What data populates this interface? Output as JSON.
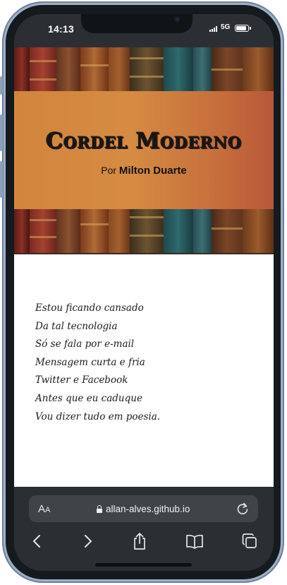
{
  "status_bar": {
    "time": "14:13",
    "network": "5G"
  },
  "header": {
    "site_title": "Cordel Moderno",
    "byline_prefix": "Por",
    "author": "Milton Duarte",
    "banner_gradient_colors": [
      "#d2863d",
      "#c56d3b",
      "#b8573a"
    ]
  },
  "poem": {
    "lines": [
      "Estou ficando cansado",
      "Da tal tecnologia",
      "Só se fala por e-mail",
      "Mensagem curta e fria",
      "Twitter e Facebook",
      "Antes que eu caduque",
      "Vou dizer tudo em poesia."
    ]
  },
  "browser": {
    "text_size_label_large": "A",
    "text_size_label_small": "A",
    "url": "allan-alves.github.io",
    "toolbar_icons": [
      "back-icon",
      "forward-icon",
      "share-icon",
      "bookmarks-icon",
      "tabs-icon"
    ],
    "icons": [
      "lock-icon",
      "reload-icon"
    ]
  }
}
